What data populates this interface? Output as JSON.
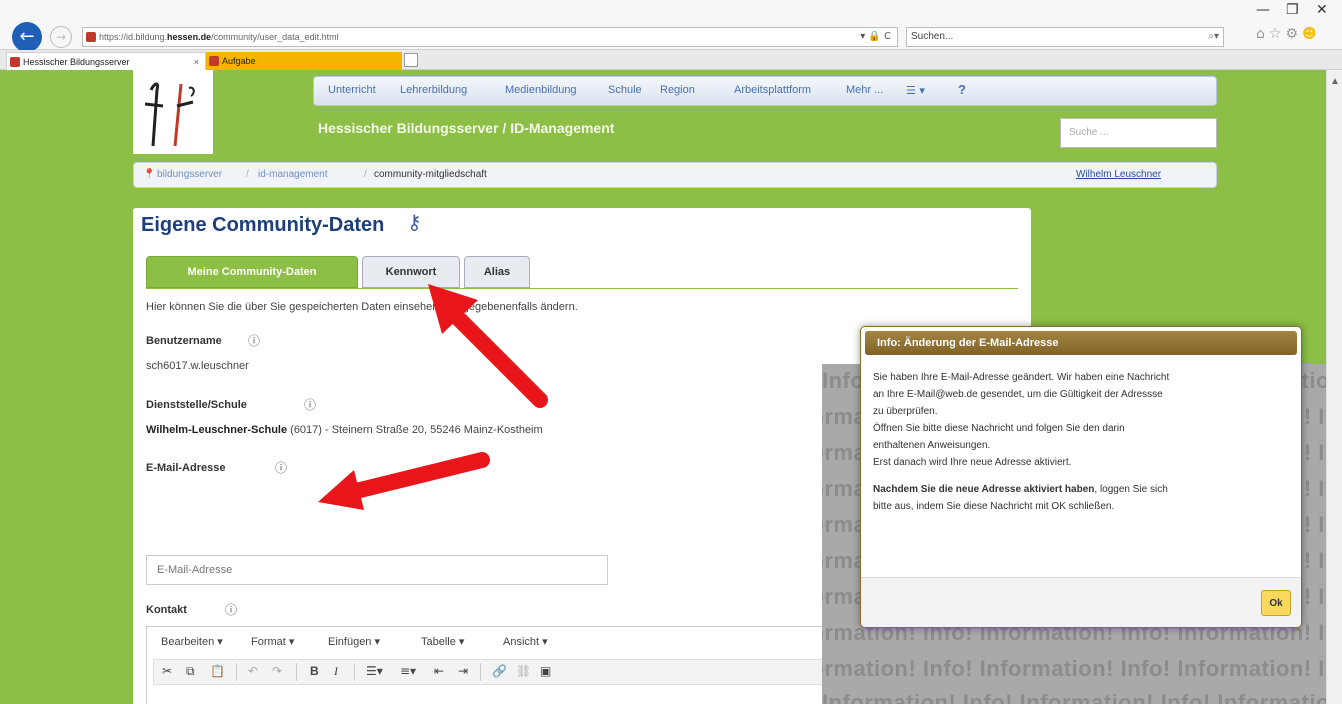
{
  "browser": {
    "url_prefix": "https://id.bildung.",
    "url_host": "hessen.de",
    "url_path": "/community/user_data_edit.html",
    "url_controls": "▾ 🔒 C",
    "search_placeholder": "Suchen...",
    "tabs": [
      {
        "label": "Hessischer Bildungsserver",
        "close": "×"
      },
      {
        "label": "Aufgabe"
      }
    ],
    "window_controls": {
      "minimize": "—",
      "maximize": "❐",
      "close": "✕"
    }
  },
  "site": {
    "nav": [
      "Unterricht",
      "Lehrerbildung",
      "Medienbildung",
      "Schule",
      "Region",
      "Arbeitsplattform",
      "Mehr ..."
    ],
    "nav_menu": "☰ ▾",
    "nav_help": "?",
    "title": "Hessischer Bildungsserver / ID-Management",
    "search_placeholder": "Suche ..."
  },
  "breadcrumb": {
    "items": [
      "bildungsserver",
      "id-management",
      "community-mitgliedschaft"
    ],
    "user": "Wilhelm Leuschner"
  },
  "page": {
    "heading": "Eigene Community-Daten",
    "tabs": [
      "Meine Community-Daten",
      "Kennwort",
      "Alias"
    ],
    "intro": "Hier können Sie die über Sie gespeicherten Daten einsehen und gegebenenfalls ändern.",
    "fields": {
      "username_label": "Benutzername",
      "username_value": "sch6017.w.leuschner",
      "school_label": "Dienststelle/Schule",
      "school_name": "Wilhelm-Leuschner-Schule",
      "school_rest": " (6017) - Steinern Straße 20, 55246 Mainz-Kostheim",
      "email_label": "E-Mail-Adresse",
      "email_placeholder": "E-Mail-Adresse",
      "contact_label": "Kontakt"
    },
    "editor_menu": [
      "Bearbeiten ▾",
      "Format ▾",
      "Einfügen ▾",
      "Tabelle ▾",
      "Ansicht ▾"
    ]
  },
  "overlay": {
    "watermark": "Information! Info! Information! Info! Information! Info!"
  },
  "dialog": {
    "title": "Info: Änderung der E-Mail-Adresse",
    "p1_lines": [
      "Sie haben Ihre E-Mail-Adresse geändert. Wir haben eine Nachricht",
      "an Ihre E-Mail@web.de gesendet, um die Gültigkeit der Adressse",
      "zu überprüfen.",
      "Öffnen Sie bitte diese Nachricht und folgen Sie den darin",
      "enthaltenen Anweisungen.",
      "Erst danach wird Ihre neue Adresse aktiviert."
    ],
    "p2_bold": "Nachdem Sie die neue Adresse aktiviert haben",
    "p2_rest": ", loggen Sie sich",
    "p2_line2": "bitte aus, indem Sie diese Nachricht mit OK schließen.",
    "ok_label": "Ok"
  },
  "colors": {
    "page_green": "#8dbf46",
    "arrow_red": "#e8151b",
    "dialog_title": "#8f7232",
    "ok_button": "#f9d85c"
  }
}
